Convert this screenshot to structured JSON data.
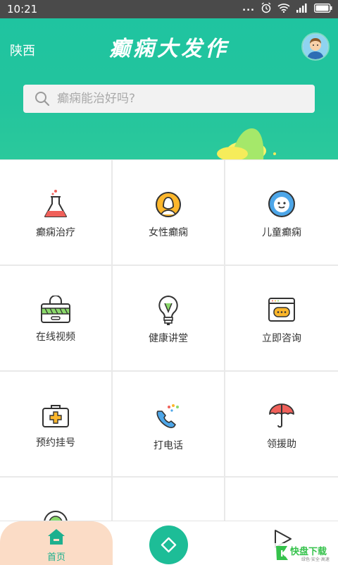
{
  "status_bar": {
    "time": "10:21",
    "more": "...",
    "battery_icon": "battery-icon"
  },
  "header": {
    "region": "陕西",
    "title": "癫痫大发作",
    "search_placeholder": "癫痫能治好吗?"
  },
  "grid": {
    "items": [
      {
        "label": "癫痫治疗",
        "icon": "flask-icon"
      },
      {
        "label": "女性癫痫",
        "icon": "woman-icon"
      },
      {
        "label": "儿童癫痫",
        "icon": "child-face-icon"
      },
      {
        "label": "在线视频",
        "icon": "video-lock-icon"
      },
      {
        "label": "健康讲堂",
        "icon": "light-bulb-icon"
      },
      {
        "label": "立即咨询",
        "icon": "chat-window-icon"
      },
      {
        "label": "预约挂号",
        "icon": "medical-kit-icon"
      },
      {
        "label": "打电话",
        "icon": "phone-icon"
      },
      {
        "label": "领援助",
        "icon": "umbrella-icon"
      }
    ]
  },
  "tabbar": {
    "home_label": "首页",
    "accent": "#1dbd97"
  },
  "watermark": {
    "name": "快盘下载",
    "tagline": "绿色·安全·高速"
  }
}
